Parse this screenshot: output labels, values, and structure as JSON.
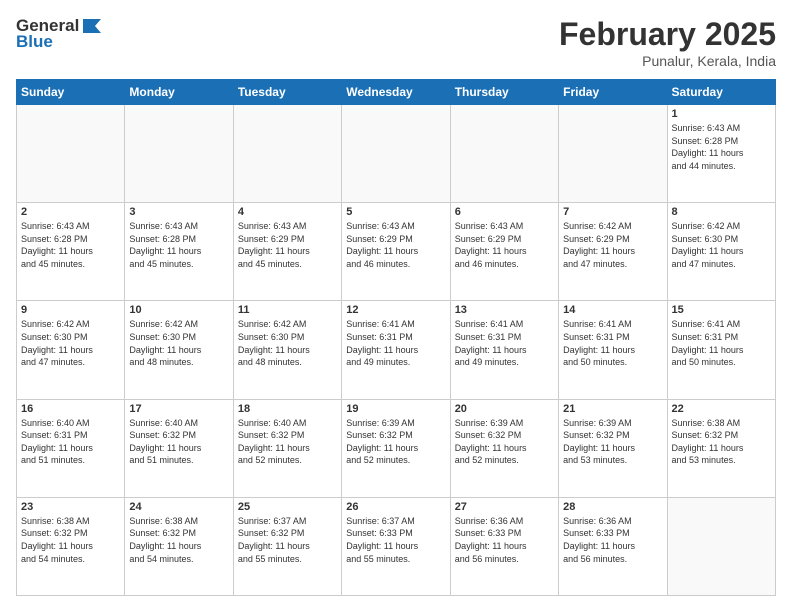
{
  "header": {
    "logo_general": "General",
    "logo_blue": "Blue",
    "month_title": "February 2025",
    "location": "Punalur, Kerala, India"
  },
  "calendar": {
    "days_of_week": [
      "Sunday",
      "Monday",
      "Tuesday",
      "Wednesday",
      "Thursday",
      "Friday",
      "Saturday"
    ],
    "weeks": [
      [
        {
          "day": "",
          "info": ""
        },
        {
          "day": "",
          "info": ""
        },
        {
          "day": "",
          "info": ""
        },
        {
          "day": "",
          "info": ""
        },
        {
          "day": "",
          "info": ""
        },
        {
          "day": "",
          "info": ""
        },
        {
          "day": "1",
          "info": "Sunrise: 6:43 AM\nSunset: 6:28 PM\nDaylight: 11 hours\nand 44 minutes."
        }
      ],
      [
        {
          "day": "2",
          "info": "Sunrise: 6:43 AM\nSunset: 6:28 PM\nDaylight: 11 hours\nand 45 minutes."
        },
        {
          "day": "3",
          "info": "Sunrise: 6:43 AM\nSunset: 6:28 PM\nDaylight: 11 hours\nand 45 minutes."
        },
        {
          "day": "4",
          "info": "Sunrise: 6:43 AM\nSunset: 6:29 PM\nDaylight: 11 hours\nand 45 minutes."
        },
        {
          "day": "5",
          "info": "Sunrise: 6:43 AM\nSunset: 6:29 PM\nDaylight: 11 hours\nand 46 minutes."
        },
        {
          "day": "6",
          "info": "Sunrise: 6:43 AM\nSunset: 6:29 PM\nDaylight: 11 hours\nand 46 minutes."
        },
        {
          "day": "7",
          "info": "Sunrise: 6:42 AM\nSunset: 6:29 PM\nDaylight: 11 hours\nand 47 minutes."
        },
        {
          "day": "8",
          "info": "Sunrise: 6:42 AM\nSunset: 6:30 PM\nDaylight: 11 hours\nand 47 minutes."
        }
      ],
      [
        {
          "day": "9",
          "info": "Sunrise: 6:42 AM\nSunset: 6:30 PM\nDaylight: 11 hours\nand 47 minutes."
        },
        {
          "day": "10",
          "info": "Sunrise: 6:42 AM\nSunset: 6:30 PM\nDaylight: 11 hours\nand 48 minutes."
        },
        {
          "day": "11",
          "info": "Sunrise: 6:42 AM\nSunset: 6:30 PM\nDaylight: 11 hours\nand 48 minutes."
        },
        {
          "day": "12",
          "info": "Sunrise: 6:41 AM\nSunset: 6:31 PM\nDaylight: 11 hours\nand 49 minutes."
        },
        {
          "day": "13",
          "info": "Sunrise: 6:41 AM\nSunset: 6:31 PM\nDaylight: 11 hours\nand 49 minutes."
        },
        {
          "day": "14",
          "info": "Sunrise: 6:41 AM\nSunset: 6:31 PM\nDaylight: 11 hours\nand 50 minutes."
        },
        {
          "day": "15",
          "info": "Sunrise: 6:41 AM\nSunset: 6:31 PM\nDaylight: 11 hours\nand 50 minutes."
        }
      ],
      [
        {
          "day": "16",
          "info": "Sunrise: 6:40 AM\nSunset: 6:31 PM\nDaylight: 11 hours\nand 51 minutes."
        },
        {
          "day": "17",
          "info": "Sunrise: 6:40 AM\nSunset: 6:32 PM\nDaylight: 11 hours\nand 51 minutes."
        },
        {
          "day": "18",
          "info": "Sunrise: 6:40 AM\nSunset: 6:32 PM\nDaylight: 11 hours\nand 52 minutes."
        },
        {
          "day": "19",
          "info": "Sunrise: 6:39 AM\nSunset: 6:32 PM\nDaylight: 11 hours\nand 52 minutes."
        },
        {
          "day": "20",
          "info": "Sunrise: 6:39 AM\nSunset: 6:32 PM\nDaylight: 11 hours\nand 52 minutes."
        },
        {
          "day": "21",
          "info": "Sunrise: 6:39 AM\nSunset: 6:32 PM\nDaylight: 11 hours\nand 53 minutes."
        },
        {
          "day": "22",
          "info": "Sunrise: 6:38 AM\nSunset: 6:32 PM\nDaylight: 11 hours\nand 53 minutes."
        }
      ],
      [
        {
          "day": "23",
          "info": "Sunrise: 6:38 AM\nSunset: 6:32 PM\nDaylight: 11 hours\nand 54 minutes."
        },
        {
          "day": "24",
          "info": "Sunrise: 6:38 AM\nSunset: 6:32 PM\nDaylight: 11 hours\nand 54 minutes."
        },
        {
          "day": "25",
          "info": "Sunrise: 6:37 AM\nSunset: 6:32 PM\nDaylight: 11 hours\nand 55 minutes."
        },
        {
          "day": "26",
          "info": "Sunrise: 6:37 AM\nSunset: 6:33 PM\nDaylight: 11 hours\nand 55 minutes."
        },
        {
          "day": "27",
          "info": "Sunrise: 6:36 AM\nSunset: 6:33 PM\nDaylight: 11 hours\nand 56 minutes."
        },
        {
          "day": "28",
          "info": "Sunrise: 6:36 AM\nSunset: 6:33 PM\nDaylight: 11 hours\nand 56 minutes."
        },
        {
          "day": "",
          "info": ""
        }
      ]
    ]
  }
}
